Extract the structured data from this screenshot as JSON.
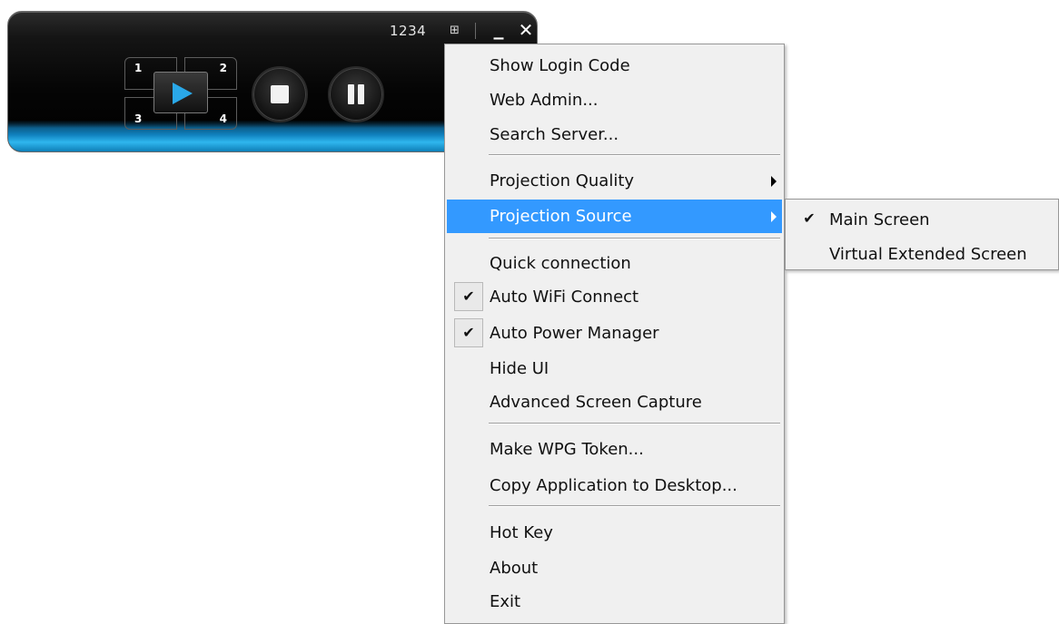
{
  "player": {
    "login_code": "1234",
    "layout_icon": "layout-grid-icon",
    "minimize_label": "_",
    "close_label": "✕",
    "quadrants": [
      "1",
      "2",
      "3",
      "4"
    ],
    "accent_color": "#2aa8e8"
  },
  "menu": {
    "items": [
      {
        "label": "Show Login Code"
      },
      {
        "label": "Web Admin..."
      },
      {
        "label": "Search Server..."
      },
      {
        "label": "Projection Quality",
        "submenu": true
      },
      {
        "label": "Projection Source",
        "submenu": true,
        "highlighted": true
      },
      {
        "label": "Quick connection"
      },
      {
        "label": "Auto WiFi Connect",
        "checked": true
      },
      {
        "label": "Auto Power Manager",
        "checked": true
      },
      {
        "label": "Hide UI"
      },
      {
        "label": "Advanced Screen Capture"
      },
      {
        "label": "Make WPG Token..."
      },
      {
        "label": "Copy Application to Desktop..."
      },
      {
        "label": "Hot Key"
      },
      {
        "label": "About"
      },
      {
        "label": "Exit"
      }
    ],
    "highlight_color": "#3399ff"
  },
  "submenu": {
    "items": [
      {
        "label": "Main Screen",
        "checked": true
      },
      {
        "label": "Virtual Extended Screen"
      }
    ]
  },
  "check_glyph": "✔"
}
